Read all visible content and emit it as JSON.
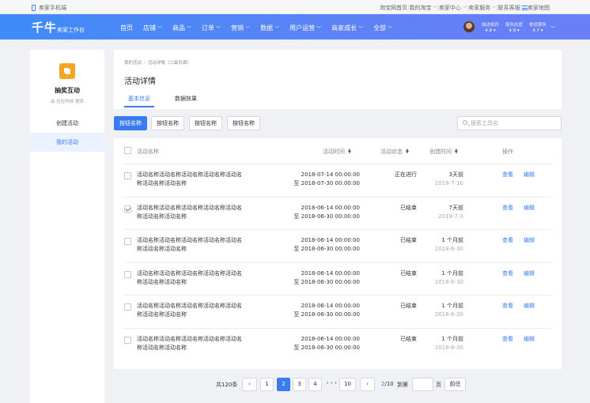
{
  "topbar": {
    "mobile_label": "卖家手机端",
    "links": [
      "淘宝网首页",
      "我的淘宝",
      "卖家中心",
      "卖家服务",
      "联系客服",
      "卖家地图"
    ]
  },
  "nav": {
    "brand": "千牛",
    "brand_sub": "卖家工作台",
    "menu": [
      "首页",
      "店铺",
      "商品",
      "订单",
      "营销",
      "数据",
      "用户运营",
      "商家成长",
      "全部"
    ],
    "scores": [
      {
        "label": "描述相符",
        "value": "4.8"
      },
      {
        "label": "服务态度",
        "value": "4.9"
      },
      {
        "label": "物流服务",
        "value": "4.7"
      }
    ]
  },
  "sidebar": {
    "app_name": "抽奖互动",
    "app_by": "由 拉拉科技 提供",
    "items": [
      "创建活动",
      "我的活动"
    ]
  },
  "header": {
    "breadcrumb": [
      "我的活动",
      "活动详情（二级页面）"
    ],
    "title": "活动详情",
    "tabs": [
      "基本信息",
      "数据效果"
    ]
  },
  "toolbar": {
    "buttons": [
      "按钮名称",
      "按钮名称",
      "按钮名称",
      "按钮名称"
    ],
    "search_placeholder": "搜索工具名"
  },
  "table": {
    "columns": [
      "活动名称",
      "活动时间",
      "活动状态",
      "创建时间",
      "操作"
    ],
    "rows": [
      {
        "name1": "活动名称活动名称活动名称活动名称活动名",
        "name2": "称活动名称活动名称",
        "start": "2018-07-14 00:00:00",
        "end": "至 2018-07-30 00:00:00",
        "status": "正在进行",
        "created": "3天前",
        "created_date": "2018-7-10",
        "checked": false
      },
      {
        "name1": "活动名称活动名称活动名称活动名称活动名",
        "name2": "称活动名称活动名称",
        "start": "2018-06-14 00:00:00",
        "end": "至 2018-06-30 00:00:00",
        "status": "已结束",
        "created": "7天前",
        "created_date": "2018-7-3",
        "checked": true
      },
      {
        "name1": "活动名称活动名称活动名称活动名称活动名",
        "name2": "称活动名称活动名称",
        "start": "2018-06-14 00:00:00",
        "end": "至 2018-06-30 00:00:00",
        "status": "已结束",
        "created": "1 个月前",
        "created_date": "2018-6-30",
        "checked": false
      },
      {
        "name1": "活动名称活动名称活动名称活动名称活动名",
        "name2": "称活动名称活动名称",
        "start": "2018-06-14 00:00:00",
        "end": "至 2018-06-30 00:00:00",
        "status": "已结束",
        "created": "1 个月前",
        "created_date": "2018-6-30",
        "checked": false
      },
      {
        "name1": "活动名称活动名称活动名称活动名称活动名",
        "name2": "称活动名称活动名称",
        "start": "2018-06-14 00:00:00",
        "end": "至 2018-06-30 00:00:00",
        "status": "已结束",
        "created": "1 个月前",
        "created_date": "2018-6-30",
        "checked": false
      },
      {
        "name1": "活动名称活动名称活动名称活动名称活动名",
        "name2": "称活动名称活动名称",
        "start": "2018-06-14 00:00:00",
        "end": "至 2018-06-30 00:00:00",
        "status": "已结束",
        "created": "1 个月前",
        "created_date": "2018-6-30",
        "checked": false
      }
    ],
    "actions": [
      "查看",
      "编辑"
    ]
  },
  "pagination": {
    "total": "共120条",
    "pages": [
      "1",
      "2",
      "3",
      "4",
      "10"
    ],
    "ellipsis": "•••",
    "current": "2",
    "page_total": "/10",
    "goto_label": "到第",
    "page_unit": "页",
    "go_button": "前往"
  },
  "colors": {
    "primary": "#3a7cf0",
    "nav_start": "#3e8bf7",
    "nav_end": "#6a7ff6",
    "app_icon": "#f5a524"
  }
}
